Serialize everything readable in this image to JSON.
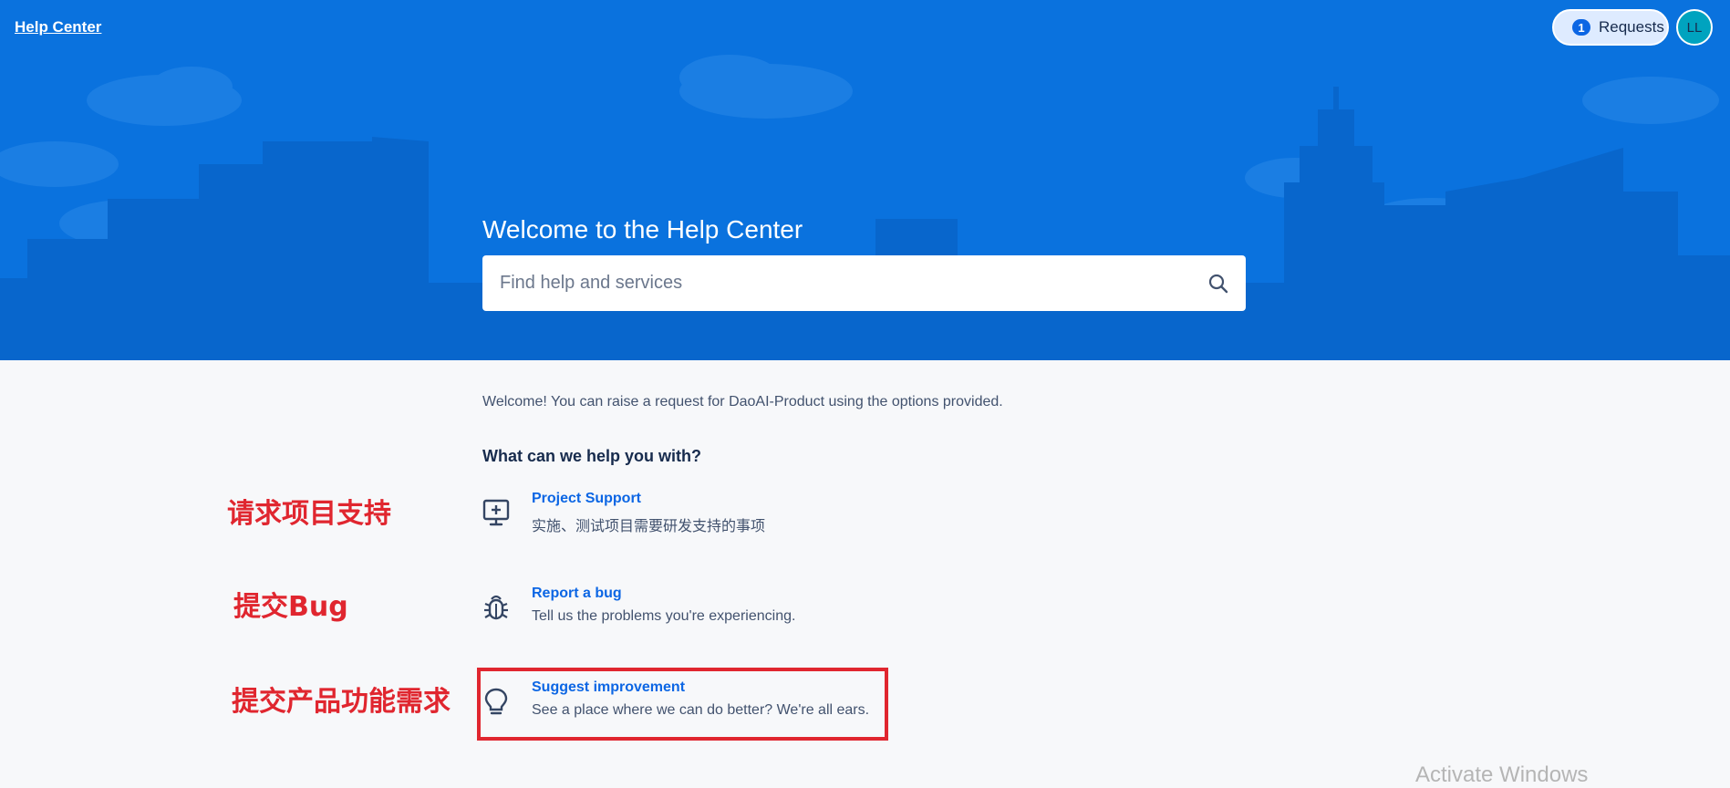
{
  "header": {
    "brand": "Help Center",
    "requests_count": "1",
    "requests_label": "Requests",
    "avatar_initials": "LL"
  },
  "hero": {
    "title": "Welcome to the Help Center",
    "search_placeholder": "Find help and services"
  },
  "main": {
    "intro": "Welcome! You can raise a request for DaoAI-Product using the options provided.",
    "section_title": "What can we help you with?",
    "options": [
      {
        "name": "Project Support",
        "description": "实施、测试项目需要研发支持的事项",
        "icon": "monitor-plus-icon"
      },
      {
        "name": "Report a bug",
        "description": "Tell us the problems you're experiencing.",
        "icon": "bug-icon"
      },
      {
        "name": "Suggest improvement",
        "description": "See a place where we can do better? We're all ears.",
        "icon": "lightbulb-icon"
      }
    ]
  },
  "annotations": [
    "请求项目支持",
    "提交Bug",
    "提交产品功能需求"
  ],
  "watermark": "Activate Windows",
  "colors": {
    "hero_background": "#0a72de",
    "link_blue": "#0c66e4",
    "annotation_red": "#e0262f",
    "page_background": "#f7f8fa"
  }
}
